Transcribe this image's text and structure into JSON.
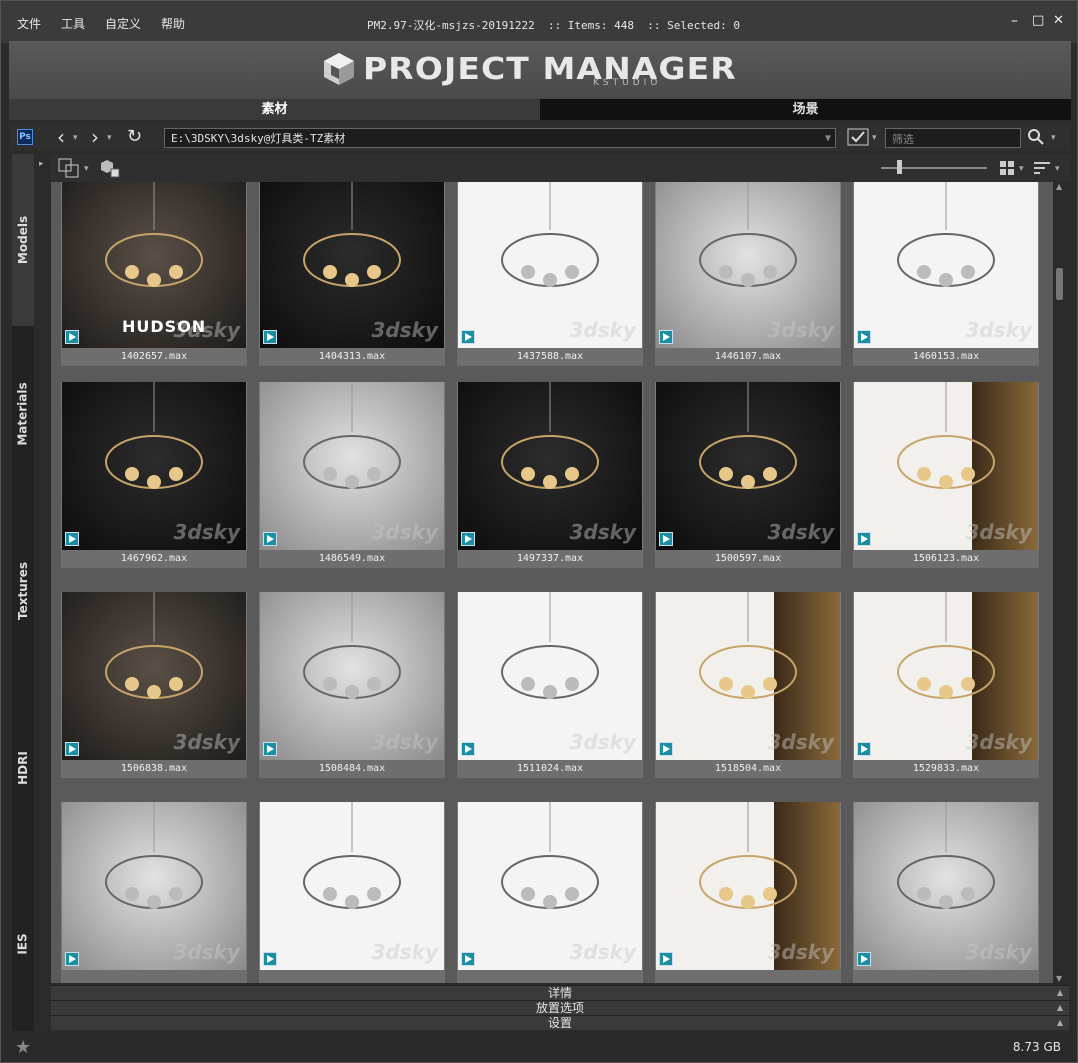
{
  "menu": [
    "文件",
    "工具",
    "自定义",
    "帮助"
  ],
  "title": "PM2.97-汉化-msjzs-20191222  :: Items: 448  :: Selected: 0",
  "window_controls": [
    "–",
    "□",
    "✕"
  ],
  "logo": {
    "word": "PROJECT MANAGER",
    "sub": "KSTUDIO"
  },
  "tabs": [
    {
      "label": "素材",
      "active": true
    },
    {
      "label": "场景",
      "active": false
    }
  ],
  "address": {
    "ps_label": "Ps",
    "path": "E:\\3DSKY\\3dsky@灯具类-TZ素材",
    "filter_placeholder": "筛选"
  },
  "sidebar": [
    {
      "label": "Models",
      "active": true
    },
    {
      "label": "Materials",
      "active": false
    },
    {
      "label": "Textures",
      "active": false
    },
    {
      "label": "HDRI",
      "active": false
    },
    {
      "label": "IES",
      "active": false
    }
  ],
  "items": [
    {
      "file": "1402657.max",
      "style": "dark",
      "brand": "HUDSON"
    },
    {
      "file": "1404313.max",
      "style": "black",
      "brand": ""
    },
    {
      "file": "1437588.max",
      "style": "light",
      "brand": ""
    },
    {
      "file": "1446107.max",
      "style": "gray",
      "brand": ""
    },
    {
      "file": "1460153.max",
      "style": "light",
      "brand": ""
    },
    {
      "file": "1467962.max",
      "style": "black",
      "brand": ""
    },
    {
      "file": "1486549.max",
      "style": "gray",
      "brand": ""
    },
    {
      "file": "1497337.max",
      "style": "black",
      "brand": ""
    },
    {
      "file": "1500597.max",
      "style": "black",
      "brand": ""
    },
    {
      "file": "1506123.max",
      "style": "warm",
      "brand": ""
    },
    {
      "file": "1506838.max",
      "style": "dark",
      "brand": ""
    },
    {
      "file": "1508484.max",
      "style": "gray",
      "brand": ""
    },
    {
      "file": "1511024.max",
      "style": "light",
      "brand": ""
    },
    {
      "file": "1518504.max",
      "style": "warm",
      "brand": ""
    },
    {
      "file": "1529833.max",
      "style": "warm",
      "brand": ""
    },
    {
      "file": "",
      "style": "gray",
      "brand": ""
    },
    {
      "file": "",
      "style": "light",
      "brand": ""
    },
    {
      "file": "",
      "style": "light",
      "brand": ""
    },
    {
      "file": "",
      "style": "warm",
      "brand": ""
    },
    {
      "file": "",
      "style": "gray",
      "brand": ""
    }
  ],
  "watermark": "3dsky",
  "panels": [
    "详情",
    "放置选项",
    "设置"
  ],
  "status": {
    "size": "8.73 GB"
  }
}
